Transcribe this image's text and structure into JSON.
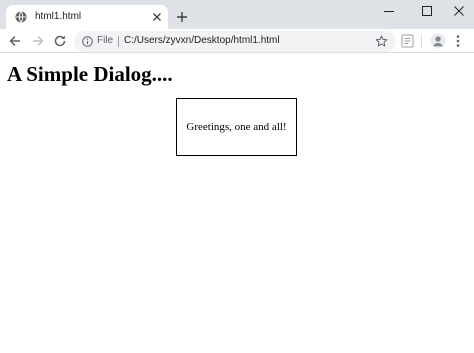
{
  "browser": {
    "tab": {
      "title": "html1.html",
      "favicon": "globe-icon",
      "close_icon": "close-icon"
    },
    "new_tab_icon": "plus-icon",
    "window_controls": [
      "minimize-icon",
      "maximize-icon",
      "window-close-icon"
    ],
    "toolbar": {
      "back_icon": "arrow-left-icon",
      "forward_icon": "arrow-right-icon",
      "reload_icon": "reload-icon",
      "omnibox": {
        "scheme_icon": "info-icon",
        "scheme_label": "File",
        "url": "C:/Users/zyvxn/Desktop/html1.html",
        "bookmark_icon": "star-icon"
      },
      "extension_icon": "reading-list-icon",
      "profile_icon": "avatar-icon",
      "menu_icon": "kebab-menu-icon"
    },
    "colors": {
      "titlebar_bg": "#dee1e6",
      "tab_bg": "#ffffff",
      "omnibox_bg": "#f1f3f4",
      "icon_color": "#5f6368"
    }
  },
  "page": {
    "heading": "A Simple Dialog....",
    "dialog": {
      "message": "Greetings, one and all!"
    }
  }
}
